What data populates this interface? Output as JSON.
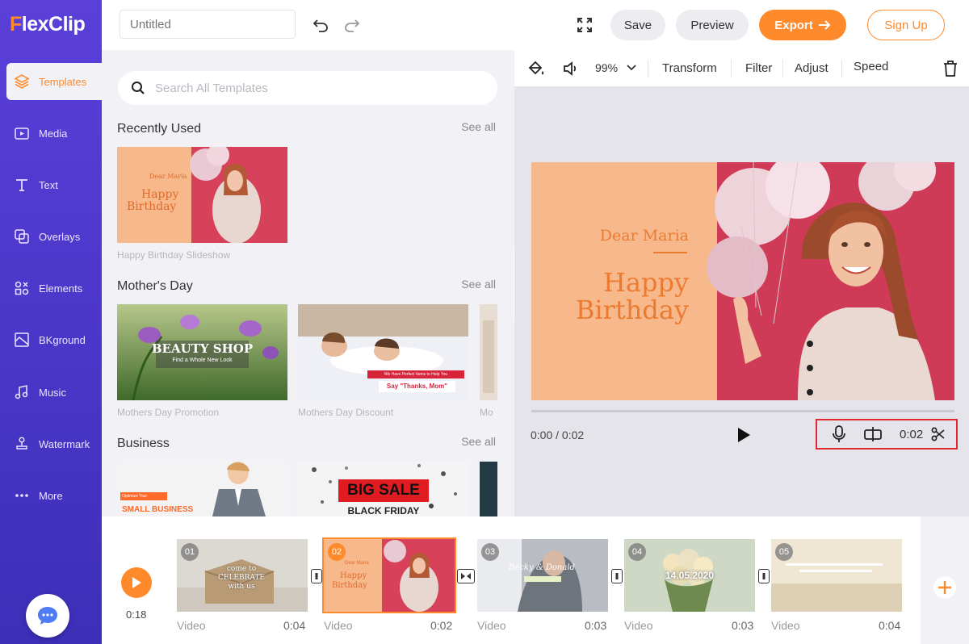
{
  "app": {
    "logo_first": "F",
    "logo_rest": "lexClip"
  },
  "sidebar": {
    "items": [
      {
        "label": "Templates",
        "icon": "layers-icon"
      },
      {
        "label": "Media",
        "icon": "folder-media-icon"
      },
      {
        "label": "Text",
        "icon": "text-icon"
      },
      {
        "label": "Overlays",
        "icon": "overlays-icon"
      },
      {
        "label": "Elements",
        "icon": "elements-icon"
      },
      {
        "label": "BKground",
        "icon": "background-icon"
      },
      {
        "label": "Music",
        "icon": "music-icon"
      },
      {
        "label": "Watermark",
        "icon": "watermark-icon"
      },
      {
        "label": "More",
        "icon": "more-icon"
      }
    ],
    "chat_icon": "chat-icon"
  },
  "header": {
    "title_placeholder": "Untitled",
    "save": "Save",
    "preview": "Preview",
    "export": "Export",
    "signup": "Sign Up"
  },
  "templates": {
    "search_placeholder": "Search All Templates",
    "sections": [
      {
        "title": "Recently Used",
        "see_all": "See all",
        "items": [
          {
            "caption": "Happy Birthday Slideshow",
            "t1": "Dear Maria",
            "t2": "Happy",
            "t3": "Birthday"
          }
        ]
      },
      {
        "title": "Mother's Day",
        "see_all": "See all",
        "items": [
          {
            "caption": "Mothers Day Promotion",
            "t1": "BEAUTY SHOP",
            "t2": "Find a Whole New Look"
          },
          {
            "caption": "Mothers Day Discount",
            "t1": "We Have Perfect Items to Help You",
            "t2": "Say \"Thanks, Mom\""
          },
          {
            "caption": "Mo"
          }
        ]
      },
      {
        "title": "Business",
        "see_all": "See all",
        "items": [
          {
            "t1": "Optimize Your",
            "t2": "SMALL BUSINESS"
          },
          {
            "t1": "BIG SALE",
            "t2": "BLACK FRIDAY"
          }
        ]
      }
    ]
  },
  "editor": {
    "zoom": "99%",
    "tools": [
      "Transform",
      "Filter",
      "Adjust",
      "Speed"
    ],
    "canvas": {
      "line1": "Dear Maria",
      "line2": "Happy",
      "line3": "Birthday"
    },
    "time": "0:00 / 0:02",
    "clip_time": "0:02"
  },
  "timeline": {
    "total": "0:18",
    "clips": [
      {
        "num": "01",
        "label": "Video",
        "duration": "0:04",
        "text": "come to CELEBRATE with us"
      },
      {
        "num": "02",
        "label": "Video",
        "duration": "0:02",
        "text1": "Dear Maria",
        "text2": "Happy",
        "text3": "Birthday"
      },
      {
        "num": "03",
        "label": "Video",
        "duration": "0:03",
        "text": "Becky & Donald"
      },
      {
        "num": "04",
        "label": "Video",
        "duration": "0:03",
        "text": "14.05.2020"
      },
      {
        "num": "05",
        "label": "Video",
        "duration": "0:04"
      }
    ]
  },
  "colors": {
    "accent": "#ff8a2b",
    "sidebar": "#4a36c8",
    "highlight": "#e0282e"
  }
}
